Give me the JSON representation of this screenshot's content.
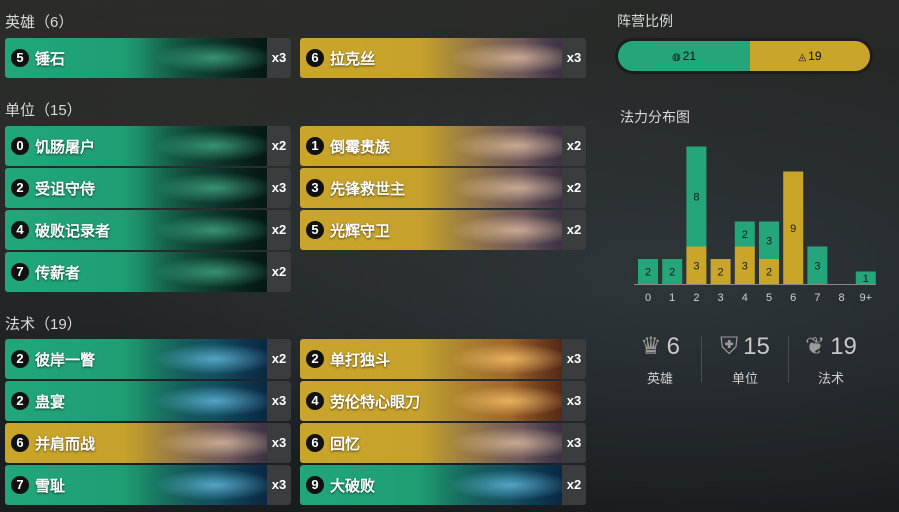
{
  "sections": {
    "champions": {
      "title": "英雄（6）"
    },
    "units": {
      "title": "单位（15）"
    },
    "spells": {
      "title": "法术（19）"
    }
  },
  "cards": {
    "champions": [
      {
        "cost": "5",
        "name": "锤石",
        "count": "x3",
        "color": "green"
      },
      {
        "cost": "6",
        "name": "拉克丝",
        "count": "x3",
        "color": "gold"
      }
    ],
    "units": [
      {
        "cost": "0",
        "name": "饥肠屠户",
        "count": "x2",
        "color": "green"
      },
      {
        "cost": "1",
        "name": "倒霉贵族",
        "count": "x2",
        "color": "gold"
      },
      {
        "cost": "2",
        "name": "受诅守侍",
        "count": "x3",
        "color": "green"
      },
      {
        "cost": "3",
        "name": "先锋救世主",
        "count": "x2",
        "color": "gold"
      },
      {
        "cost": "4",
        "name": "破败记录者",
        "count": "x2",
        "color": "green"
      },
      {
        "cost": "5",
        "name": "光辉守卫",
        "count": "x2",
        "color": "gold"
      },
      {
        "cost": "7",
        "name": "传薪者",
        "count": "x2",
        "color": "green"
      }
    ],
    "spells": [
      {
        "cost": "2",
        "name": "彼岸一瞥",
        "count": "x2",
        "color": "green"
      },
      {
        "cost": "2",
        "name": "单打独斗",
        "count": "x3",
        "color": "gold"
      },
      {
        "cost": "2",
        "name": "蛊宴",
        "count": "x3",
        "color": "green"
      },
      {
        "cost": "4",
        "name": "劳伦特心眼刀",
        "count": "x3",
        "color": "gold"
      },
      {
        "cost": "6",
        "name": "并肩而战",
        "count": "x3",
        "color": "gold"
      },
      {
        "cost": "6",
        "name": "回忆",
        "count": "x3",
        "color": "gold"
      },
      {
        "cost": "7",
        "name": "雪耻",
        "count": "x3",
        "color": "green"
      },
      {
        "cost": "9",
        "name": "大破败",
        "count": "x2",
        "color": "green"
      }
    ]
  },
  "region_ratio": {
    "title": "阵营比例",
    "segments": [
      {
        "region": "Shadow Isles",
        "icon": "shadow-isles-icon",
        "value": 21,
        "label": "21",
        "color": "#25a57a"
      },
      {
        "region": "Targon",
        "icon": "targon-icon",
        "value": 19,
        "label": "19",
        "color": "#c9a52a"
      }
    ]
  },
  "mana_curve": {
    "title": "法力分布图",
    "chart_data": {
      "type": "bar",
      "categories": [
        "0",
        "1",
        "2",
        "3",
        "4",
        "5",
        "6",
        "7",
        "8",
        "9+"
      ],
      "series": [
        {
          "color": "#25a57a",
          "values": [
            2,
            2,
            8,
            0,
            2,
            3,
            0,
            3,
            0,
            1
          ]
        },
        {
          "color": "#c9a52a",
          "values": [
            0,
            0,
            3,
            2,
            3,
            2,
            9,
            0,
            0,
            0
          ]
        }
      ],
      "stacked": true,
      "ylim": [
        0,
        11
      ]
    }
  },
  "type_stats": [
    {
      "icon": "champion-icon",
      "glyph": "♛",
      "value": "6",
      "label": "英雄"
    },
    {
      "icon": "unit-icon",
      "glyph": "⛨",
      "value": "15",
      "label": "单位"
    },
    {
      "icon": "spell-icon",
      "glyph": "❦",
      "value": "19",
      "label": "法术"
    }
  ],
  "colors": {
    "green": "#25a57a",
    "gold": "#c9a52a",
    "count_bg": "#3a3c3e"
  }
}
